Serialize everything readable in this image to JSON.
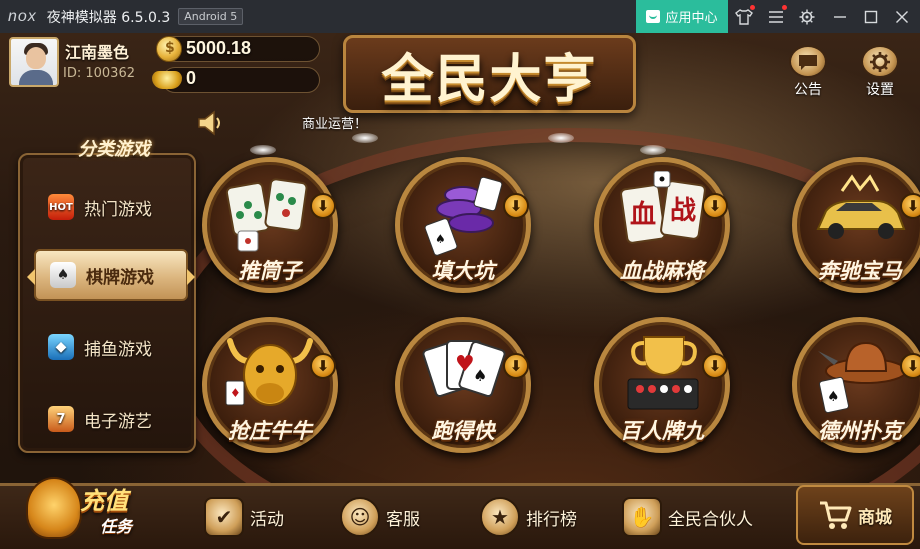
{
  "emulator": {
    "logo": "nox",
    "title": "夜神模拟器 6.5.0.3",
    "android_badge": "Android 5",
    "app_center_label": "应用中心",
    "icons": [
      "shirt-icon",
      "menu-icon",
      "gear-icon",
      "minimize-icon",
      "maximize-icon",
      "close-icon"
    ]
  },
  "user": {
    "nickname": "江南墨色",
    "id": "ID: 100362",
    "gold": "5000.18",
    "ingot": "0"
  },
  "logo_text": "全民大亨",
  "notice": "商业运营！",
  "top_buttons": [
    {
      "label": "公告",
      "icon": "notice-icon"
    },
    {
      "label": "设置",
      "icon": "gear-icon"
    }
  ],
  "categories": {
    "title": "分类游戏",
    "items": [
      {
        "label": "热门游戏",
        "icon": "hot-icon",
        "active": false
      },
      {
        "label": "棋牌游戏",
        "icon": "cards-icon",
        "active": true
      },
      {
        "label": "捕鱼游戏",
        "icon": "fish-icon",
        "active": false
      },
      {
        "label": "电子游艺",
        "icon": "slot-icon",
        "active": false
      }
    ]
  },
  "games": [
    {
      "name": "推筒子",
      "icon": "mahjong-tiles-icon"
    },
    {
      "name": "填大坑",
      "icon": "chips-cards-icon"
    },
    {
      "name": "血战麻将",
      "icon": "mahjong-icon"
    },
    {
      "name": "奔驰宝马",
      "icon": "car-icon"
    },
    {
      "name": "抢庄牛牛",
      "icon": "bull-icon"
    },
    {
      "name": "跑得快",
      "icon": "playing-cards-icon"
    },
    {
      "name": "百人牌九",
      "icon": "trophy-icon"
    },
    {
      "name": "德州扑克",
      "icon": "cowboy-hat-icon"
    }
  ],
  "bottom": {
    "charge_title": "充值",
    "charge_sub": "任务",
    "nav": [
      {
        "label": "活动",
        "icon": "calendar-check-icon"
      },
      {
        "label": "客服",
        "icon": "support-face-icon"
      },
      {
        "label": "排行榜",
        "icon": "rank-star-icon"
      },
      {
        "label": "全民合伙人",
        "icon": "handshake-icon"
      }
    ],
    "shop_label": "商城",
    "shop_icon": "cart-icon"
  },
  "colors": {
    "gold": "#b9873f",
    "accent_green": "#2bbd9c",
    "title_bar": "#2a2d33"
  }
}
